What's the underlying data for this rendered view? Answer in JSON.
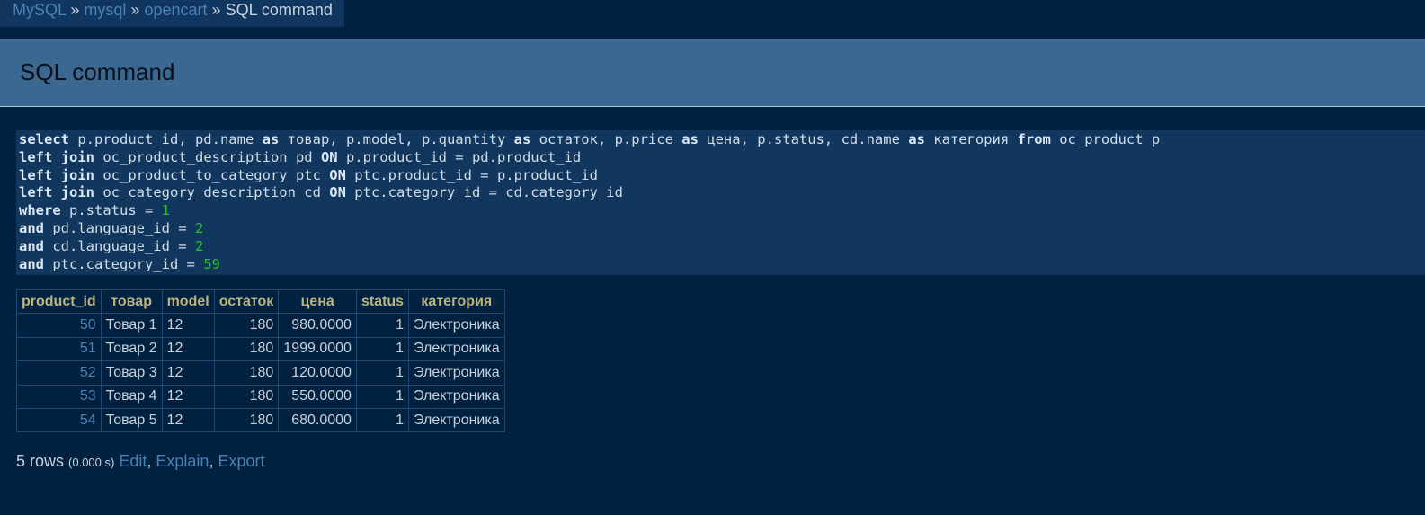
{
  "breadcrumb": {
    "items": [
      "MySQL",
      "mysql",
      "opencart"
    ],
    "separator": "»",
    "current": "SQL command"
  },
  "page_title": "SQL command",
  "sql": {
    "lines": [
      [
        {
          "t": "select",
          "k": "kw"
        },
        {
          "t": " p.product_id, pd.name "
        },
        {
          "t": "as",
          "k": "kw"
        },
        {
          "t": " товар, p.model, p.quantity "
        },
        {
          "t": "as",
          "k": "kw"
        },
        {
          "t": " остаток, p.price "
        },
        {
          "t": "as",
          "k": "kw"
        },
        {
          "t": " цена, p.status, cd.name "
        },
        {
          "t": "as",
          "k": "kw"
        },
        {
          "t": " категория "
        },
        {
          "t": "from",
          "k": "kw"
        },
        {
          "t": " oc_product p"
        }
      ],
      [
        {
          "t": "left join",
          "k": "kw"
        },
        {
          "t": " oc_product_description pd "
        },
        {
          "t": "ON",
          "k": "kw"
        },
        {
          "t": " p.product_id = pd.product_id"
        }
      ],
      [
        {
          "t": "left join",
          "k": "kw"
        },
        {
          "t": " oc_product_to_category ptc "
        },
        {
          "t": "ON",
          "k": "kw"
        },
        {
          "t": " ptc.product_id = p.product_id"
        }
      ],
      [
        {
          "t": "left join",
          "k": "kw"
        },
        {
          "t": " oc_category_description cd "
        },
        {
          "t": "ON",
          "k": "kw"
        },
        {
          "t": " ptc.category_id = cd.category_id"
        }
      ],
      [
        {
          "t": "where",
          "k": "kw"
        },
        {
          "t": " p.status = "
        },
        {
          "t": "1",
          "k": "num"
        }
      ],
      [
        {
          "t": "and",
          "k": "kw"
        },
        {
          "t": " pd.language_id = "
        },
        {
          "t": "2",
          "k": "num"
        }
      ],
      [
        {
          "t": "and",
          "k": "kw"
        },
        {
          "t": " cd.language_id = "
        },
        {
          "t": "2",
          "k": "num"
        }
      ],
      [
        {
          "t": "and",
          "k": "kw"
        },
        {
          "t": " ptc.category_id = "
        },
        {
          "t": "59",
          "k": "num"
        }
      ]
    ]
  },
  "table": {
    "columns": [
      "product_id",
      "товар",
      "model",
      "остаток",
      "цена",
      "status",
      "категория"
    ],
    "rows": [
      [
        "50",
        "Товар 1",
        "12",
        "180",
        "980.0000",
        "1",
        "Электроника"
      ],
      [
        "51",
        "Товар 2",
        "12",
        "180",
        "1999.0000",
        "1",
        "Электроника"
      ],
      [
        "52",
        "Товар 3",
        "12",
        "180",
        "120.0000",
        "1",
        "Электроника"
      ],
      [
        "53",
        "Товар 4",
        "12",
        "180",
        "550.0000",
        "1",
        "Электроника"
      ],
      [
        "54",
        "Товар 5",
        "12",
        "180",
        "680.0000",
        "1",
        "Электроника"
      ]
    ]
  },
  "footer": {
    "rows_text": "5 rows",
    "time_text": "(0.000 s)",
    "links": [
      "Edit",
      "Explain",
      "Export"
    ]
  },
  "colors": {
    "background": "#00213f",
    "header_bg": "#3b6890",
    "link": "#4a82b4",
    "table_header_text": "#bcb57a",
    "sql_number": "#22c322"
  }
}
